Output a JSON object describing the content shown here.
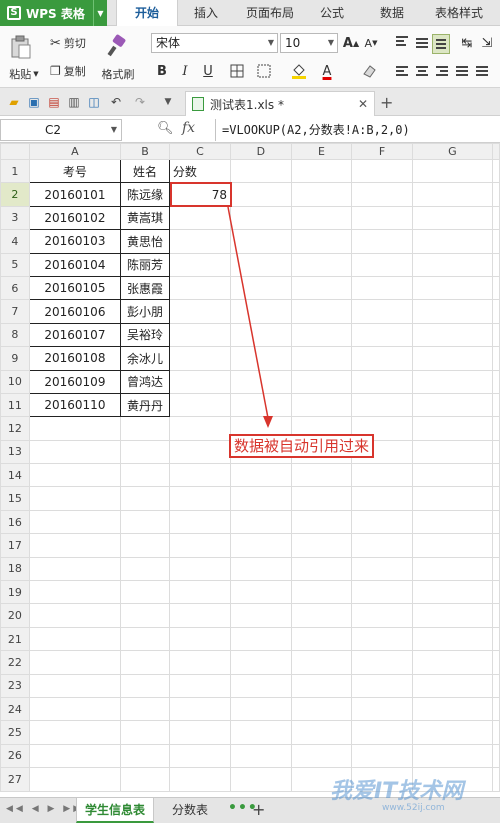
{
  "app": {
    "logo_label": "WPS 表格",
    "menu_tabs": [
      "开始",
      "插入",
      "页面布局",
      "公式",
      "数据",
      "表格样式"
    ],
    "active_menu_tab": "开始"
  },
  "ribbon": {
    "paste_label": "粘贴",
    "cut_label": "剪切",
    "copy_label": "复制",
    "format_painter_label": "格式刷",
    "font_name": "宋体",
    "font_size": "10",
    "bold_label": "B",
    "italic_label": "I",
    "underline_label": "U",
    "grow_font_label": "A",
    "shrink_font_label": "A",
    "font_color_label": "A"
  },
  "document_tab": {
    "title": "测试表1.xls *"
  },
  "formula_bar": {
    "cell_ref": "C2",
    "fx_label": "fx",
    "formula": "=VLOOKUP(A2,分数表!A:B,2,0)"
  },
  "sheet": {
    "columns": [
      "A",
      "B",
      "C",
      "D",
      "E",
      "F",
      "G"
    ],
    "row_numbers": [
      "1",
      "2",
      "3",
      "4",
      "5",
      "6",
      "7",
      "8",
      "9",
      "10",
      "11",
      "12",
      "13",
      "14",
      "15",
      "16",
      "17",
      "18",
      "19",
      "20",
      "21",
      "22",
      "23",
      "24",
      "25",
      "26",
      "27"
    ],
    "header_row": [
      "考号",
      "姓名",
      "分数"
    ],
    "data_rows": [
      [
        "20160101",
        "陈远缘",
        "78"
      ],
      [
        "20160102",
        "黄嵩琪",
        ""
      ],
      [
        "20160103",
        "黄思怡",
        ""
      ],
      [
        "20160104",
        "陈丽芳",
        ""
      ],
      [
        "20160105",
        "张惠霞",
        ""
      ],
      [
        "20160106",
        "彭小朋",
        ""
      ],
      [
        "20160107",
        "吴裕玲",
        ""
      ],
      [
        "20160108",
        "余冰儿",
        ""
      ],
      [
        "20160109",
        "曾鸿达",
        ""
      ],
      [
        "20160110",
        "黄丹丹",
        ""
      ]
    ],
    "selected_column": "C",
    "selected_row": "2"
  },
  "annotation": {
    "text": "数据被自动引用过来",
    "color": "#d8352d"
  },
  "sheet_tabs": {
    "tabs": [
      "学生信息表",
      "分数表"
    ],
    "active": "学生信息表",
    "more_label": "•••",
    "add_label": "+"
  },
  "watermark": {
    "text": "我爱IT技术网",
    "sub": "www.52ij.com"
  },
  "colors": {
    "accent": "#3a9a3e",
    "highlight": "#d8352d"
  }
}
